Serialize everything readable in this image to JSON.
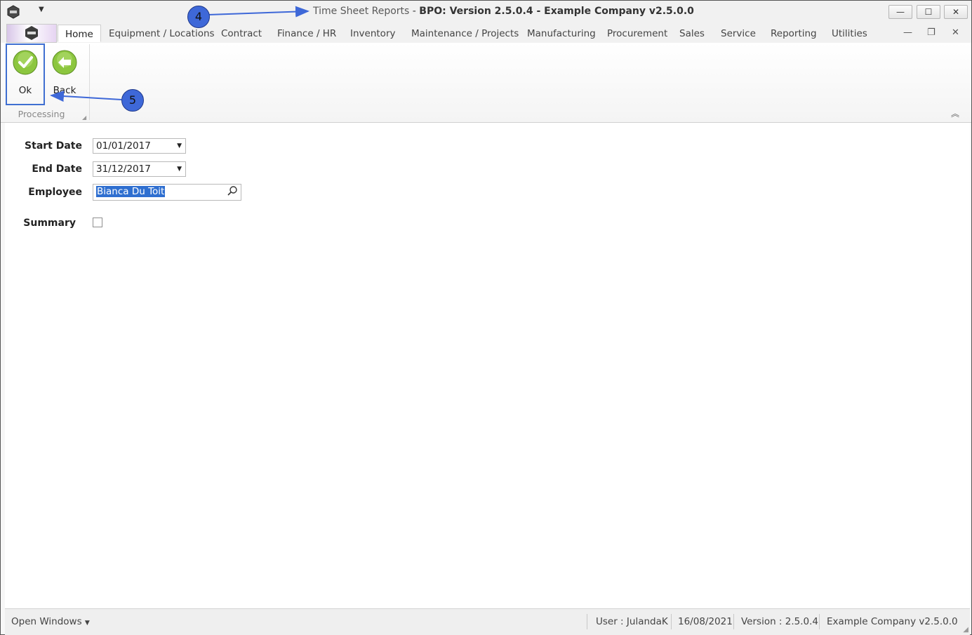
{
  "window": {
    "title_part1": "Time Sheet Reports",
    "title_sep": " - ",
    "title_part2": "BPO: Version 2.5.0.4 - Example Company v2.5.0.0"
  },
  "tabs": [
    "Home",
    "Equipment / Locations",
    "Contract",
    "Finance / HR",
    "Inventory",
    "Maintenance / Projects",
    "Manufacturing",
    "Procurement",
    "Sales",
    "Service",
    "Reporting",
    "Utilities"
  ],
  "ribbon": {
    "ok_label": "Ok",
    "back_label": "Back",
    "group_label": "Processing"
  },
  "callouts": {
    "four": "4",
    "five": "5"
  },
  "form": {
    "start_date_label": "Start Date",
    "start_date_value": "01/01/2017",
    "end_date_label": "End Date",
    "end_date_value": "31/12/2017",
    "employee_label": "Employee",
    "employee_value": "Bianca Du Toit",
    "summary_label": "Summary",
    "summary_checked": false
  },
  "statusbar": {
    "open_windows": "Open Windows",
    "user": "User : JulandaK",
    "date": "16/08/2021",
    "version": "Version : 2.5.0.4",
    "company": "Example Company v2.5.0.0"
  },
  "colors": {
    "accent": "#3e68d8",
    "selection": "#2f6fd0",
    "ok_green": "#8cc63f"
  }
}
